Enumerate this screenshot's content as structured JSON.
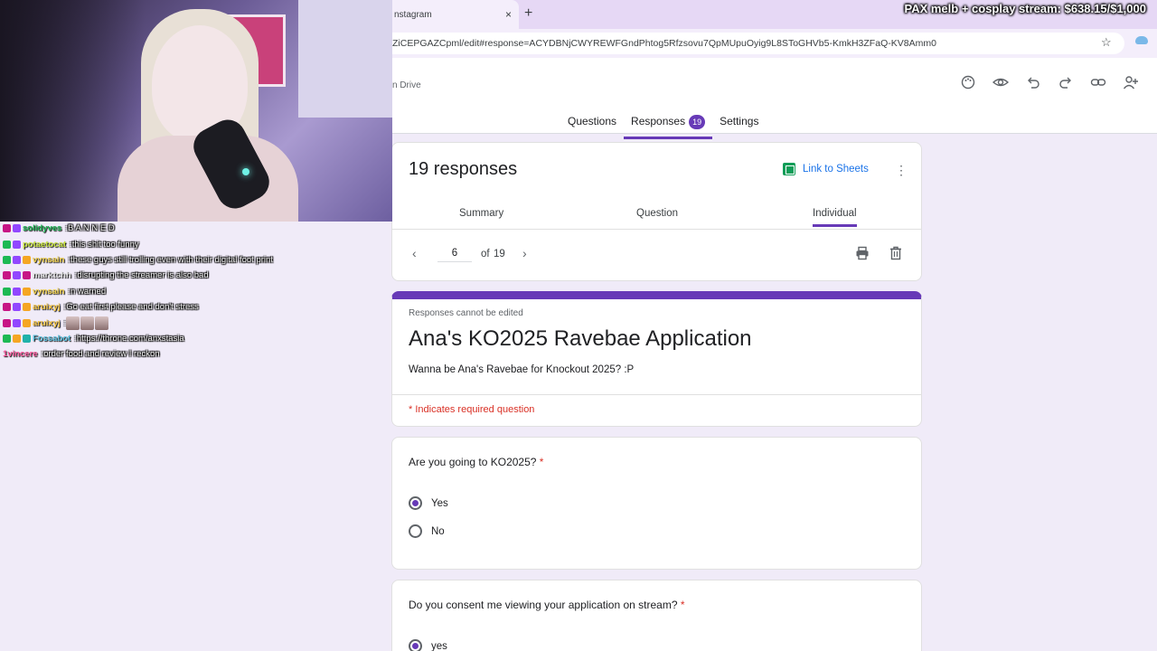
{
  "browser": {
    "tab_title": "nstagram",
    "tab_close": "×",
    "new_tab": "+",
    "url": "ZiCEPGAZCpml/edit#response=ACYDBNjCWYREWFGndPhtog5Rfzsovu7QpMUpuOyig9L8SToGHVb5-KmkH3ZFaQ-KV8Amm0",
    "star": "☆"
  },
  "stream": {
    "goal_text": "PAX melb + cosplay stream: $638.15/$1,000"
  },
  "chat": [
    {
      "user": "solidyves",
      "user_color": "#1db954",
      "sep": ": ",
      "text": "B A N N E D",
      "icons": [
        "m",
        "p"
      ]
    },
    {
      "user": "potaetocat",
      "user_color": "#c6e23a",
      "sep": ": ",
      "text": "this shit too funny",
      "icons": [
        "g",
        "p"
      ]
    },
    {
      "user": "vynsain",
      "user_color": "#f0d04a",
      "sep": ": ",
      "text": "these guys still trolling even with their digital foot print",
      "icons": [
        "g",
        "p",
        "o"
      ]
    },
    {
      "user": "marktchh",
      "user_color": "#e0e0e0",
      "sep": ": ",
      "text": "disrupting the streamer is also bad",
      "icons": [
        "m",
        "p",
        "m"
      ]
    },
    {
      "user": "vynsain",
      "user_color": "#f0d04a",
      "sep": ": ",
      "text": "n warned",
      "icons": [
        "g",
        "p",
        "o"
      ]
    },
    {
      "user": "aruixyj",
      "user_color": "#f5c542",
      "sep": ": ",
      "text": "Go eat first please and don't stress",
      "icons": [
        "m",
        "p",
        "o"
      ]
    },
    {
      "user": "aruixyj",
      "user_color": "#f5c542",
      "sep": ": ",
      "text": "",
      "icons": [
        "m",
        "p",
        "o"
      ],
      "emotes": 3
    },
    {
      "user": "Fossabot",
      "user_color": "#5bc0de",
      "sep": ": ",
      "text": "https://throne.com/anxstasia",
      "icons": [
        "g",
        "o",
        "c"
      ]
    },
    {
      "user": "1vincere",
      "user_color": "#ff5aa0",
      "sep": ": ",
      "text": "order food and review I reckon",
      "icons": []
    }
  ],
  "forms_header": {
    "drive_label": "n Drive",
    "icons": [
      "palette-icon",
      "eye-icon",
      "undo-icon",
      "redo-icon",
      "link-icon",
      "add-person-icon"
    ],
    "tabs": [
      {
        "label": "Questions"
      },
      {
        "label": "Responses",
        "badge": "19"
      },
      {
        "label": "Settings"
      }
    ]
  },
  "responses": {
    "title": "19 responses",
    "link_to_sheets": "Link to Sheets",
    "more": "⋮",
    "subtabs": [
      "Summary",
      "Question",
      "Individual"
    ],
    "pager": {
      "prev": "‹",
      "current": "6",
      "of": "of",
      "total": "19",
      "next": "›"
    }
  },
  "form": {
    "locked_note": "Responses cannot be edited",
    "title": "Ana's KO2025 Ravebae Application",
    "description": "Wanna be Ana's Ravebae for Knockout 2025? :P",
    "required_note": "* Indicates required question"
  },
  "questions": [
    {
      "text": "Are you going to KO2025?",
      "required": "*",
      "options": [
        {
          "label": "Yes",
          "selected": true
        },
        {
          "label": "No",
          "selected": false
        }
      ]
    },
    {
      "text": "Do you consent me viewing your application on stream?",
      "required": "*",
      "options": [
        {
          "label": "yes",
          "selected": true
        }
      ]
    }
  ],
  "colors": {
    "accent": "#673ab7",
    "required": "#d93025",
    "link": "#1a73e8",
    "bg": "#f0ebf8"
  }
}
